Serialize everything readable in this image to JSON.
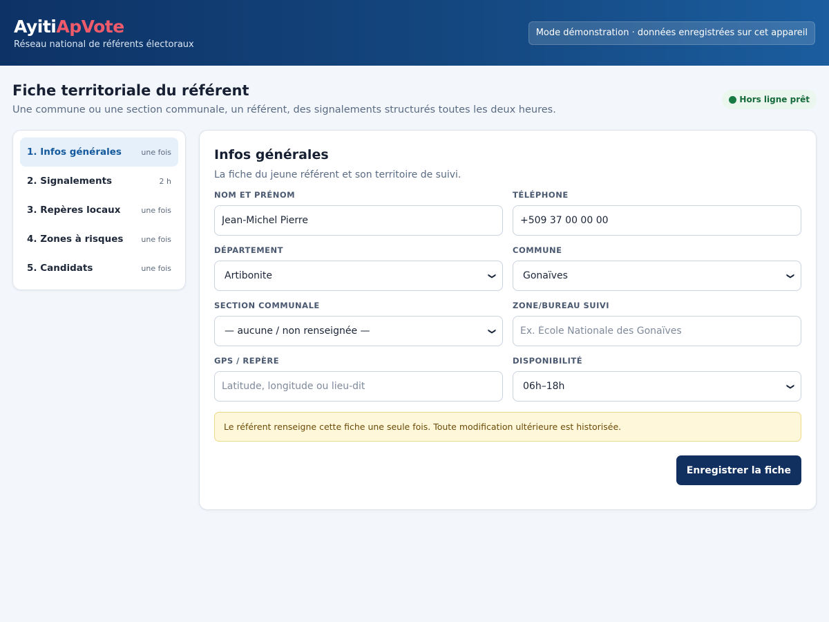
{
  "header": {
    "brand_part1": "Ayiti",
    "brand_part2": "ApVote",
    "tagline": "Réseau national de référents électoraux",
    "demo_notice": "Mode démonstration · données enregistrées sur cet appareil",
    "colors": {
      "gradient_start": "#0d3266",
      "gradient_end": "#1b5d9f",
      "brand_accent": "#ef5b6b"
    }
  },
  "page": {
    "title": "Fiche territoriale du référent",
    "subtitle": "Une commune ou une section communale, un référent, des signalements structurés toutes les deux heures.",
    "offline_status": "Hors ligne prêt",
    "offline_icon": "status-dot-green"
  },
  "sidebar": {
    "items": [
      {
        "label": "1. Infos générales",
        "frequency": "une fois",
        "active": true
      },
      {
        "label": "2. Signalements",
        "frequency": "2 h",
        "active": false
      },
      {
        "label": "3. Repères locaux",
        "frequency": "une fois",
        "active": false
      },
      {
        "label": "4. Zones à risques",
        "frequency": "une fois",
        "active": false
      },
      {
        "label": "5. Candidats",
        "frequency": "une fois",
        "active": false
      }
    ]
  },
  "form": {
    "title": "Infos générales",
    "subtitle": "La fiche du jeune référent et son territoire de suivi.",
    "fields": {
      "name": {
        "label": "NOM ET PRÉNOM",
        "value": "Jean-Michel Pierre"
      },
      "phone": {
        "label": "TÉLÉPHONE",
        "value": "+509 37 00 00 00"
      },
      "department": {
        "label": "DÉPARTEMENT",
        "value": "Artibonite"
      },
      "commune": {
        "label": "COMMUNE",
        "value": "Gonaïves"
      },
      "section": {
        "label": "SECTION COMMUNALE",
        "value": "— aucune / non renseignée —"
      },
      "zone": {
        "label": "ZONE/BUREAU SUIVI",
        "placeholder": "Ex. École Nationale des Gonaïves"
      },
      "gps": {
        "label": "GPS / REPÈRE",
        "placeholder": "Latitude, longitude ou lieu-dit"
      },
      "availability": {
        "label": "DISPONIBILITÉ",
        "value": "06h–18h"
      }
    },
    "notice": "Le référent renseigne cette fiche une seule fois. Toute modification ultérieure est historisée.",
    "save_label": "Enregistrer la fiche"
  }
}
